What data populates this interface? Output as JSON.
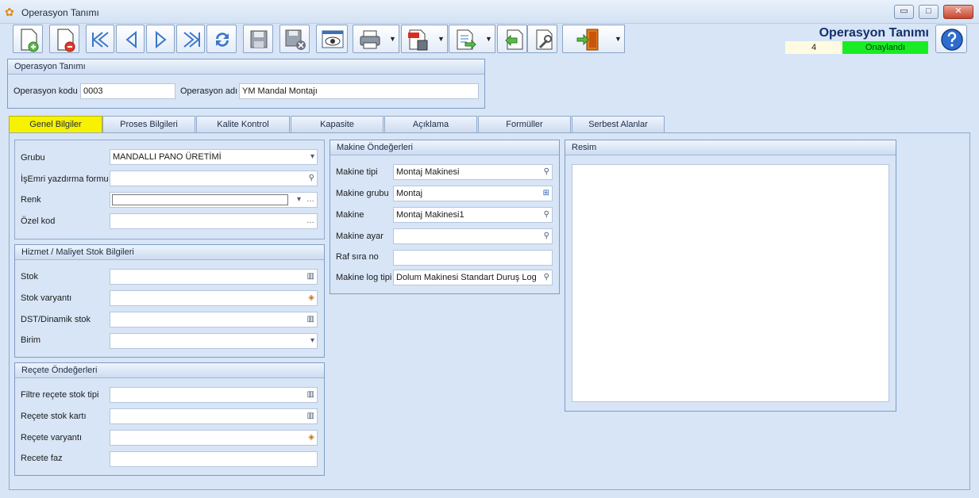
{
  "window": {
    "title": "Operasyon Tanımı",
    "buttons": {
      "minimize": "▭",
      "maximize": "□",
      "close": "✕"
    }
  },
  "header": {
    "title": "Operasyon Tanımı",
    "count": "4",
    "status": "Onaylandı",
    "status_color": "#19ec24"
  },
  "toolbar": {
    "icons": [
      "new-doc-icon",
      "delete-doc-icon",
      "first-record-icon",
      "prev-record-icon",
      "next-record-icon",
      "last-record-icon",
      "refresh-icon",
      "save-icon",
      "save-close-icon",
      "preview-icon",
      "print-icon",
      "pdf-export-icon",
      "export-icon",
      "import-icon",
      "tools-icon",
      "exit-icon",
      "help-icon"
    ]
  },
  "operation": {
    "caption": "Operasyon Tanımı",
    "code_label": "Operasyon kodu",
    "code_value": "0003",
    "name_label": "Operasyon adı",
    "name_value": "YM Mandal Montajı"
  },
  "tabs": [
    "Genel Bilgiler",
    "Proses Bilgileri",
    "Kalite Kontrol",
    "Kapasite",
    "Açıklama",
    "Formüller",
    "Serbest Alanlar"
  ],
  "general": {
    "group_label": "Grubu",
    "group_value": "MANDALLI PANO ÜRETİMİ",
    "wo_form_label": "İşEmri yazdırma formu",
    "wo_form_value": "",
    "color_label": "Renk",
    "color_value": "",
    "special_code_label": "Özel kod",
    "special_code_value": ""
  },
  "service_stock": {
    "caption": "Hizmet / Maliyet Stok Bilgileri",
    "stock_label": "Stok",
    "stock_value": "",
    "variant_label": "Stok varyantı",
    "variant_value": "",
    "dst_label": "DST/Dinamik stok",
    "dst_value": "",
    "unit_label": "Birim",
    "unit_value": ""
  },
  "recipe": {
    "caption": "Reçete Öndeğerleri",
    "filter_label": "Filtre reçete stok tipi",
    "filter_value": "",
    "card_label": "Reçete stok kartı",
    "card_value": "",
    "variant_label": "Reçete varyantı",
    "variant_value": "",
    "phase_label": "Recete faz",
    "phase_value": ""
  },
  "machine": {
    "caption": "Makine Öndeğerleri",
    "type_label": "Makine tipi",
    "type_value": "Montaj Makinesi",
    "group_label": "Makine grubu",
    "group_value": "Montaj",
    "machine_label": "Makine",
    "machine_value": "Montaj Makinesi1",
    "setup_label": "Makine ayar",
    "setup_value": "",
    "shelf_label": "Raf sıra no",
    "shelf_value": "",
    "log_label": "Makine log tipi",
    "log_value": "Dolum Makinesi Standart Duruş Log"
  },
  "image": {
    "caption": "Resim"
  }
}
